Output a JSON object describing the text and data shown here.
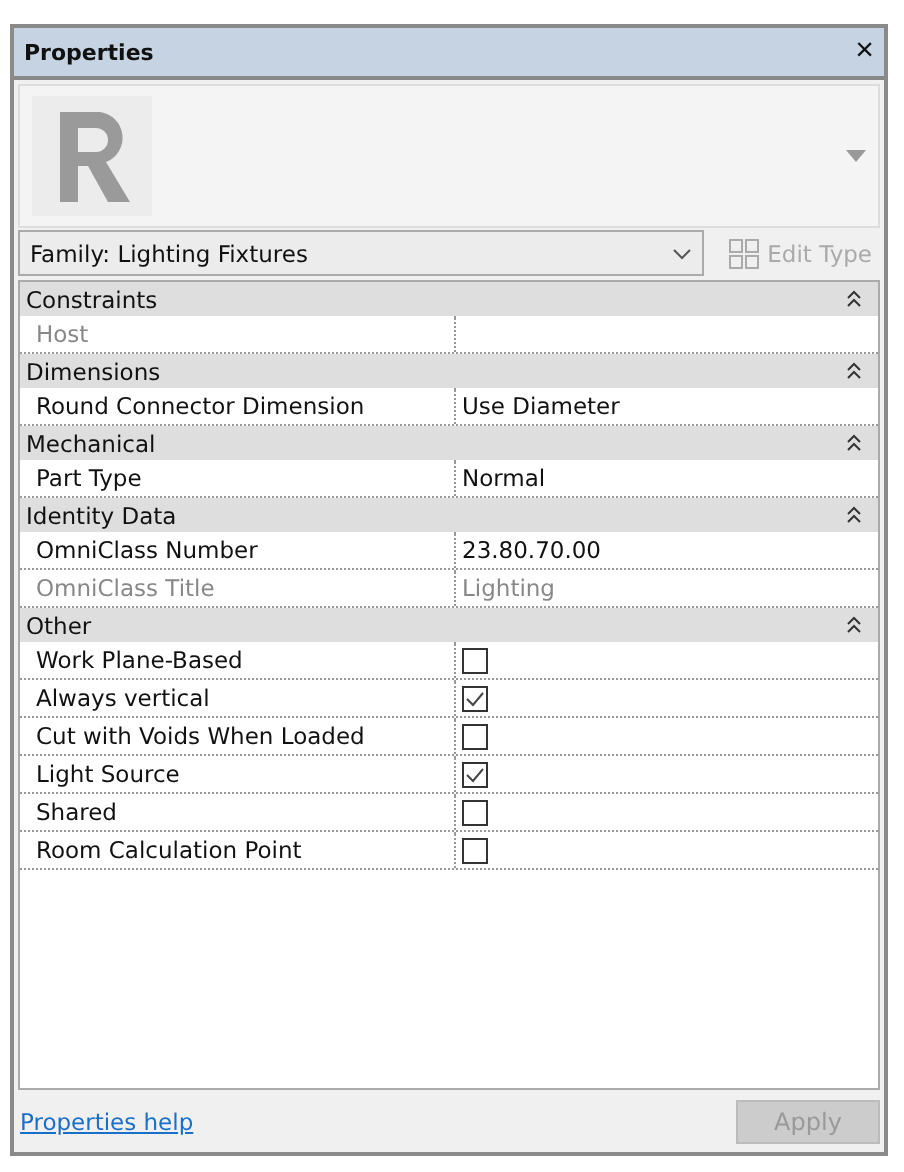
{
  "window": {
    "title": "Properties",
    "close": "×"
  },
  "type_selector": {
    "family": "Family: Lighting Fixtures",
    "edit_type": {
      "label": "Edit Type",
      "disabled": true
    }
  },
  "groups": [
    {
      "name": "Constraints",
      "expanded": true,
      "rows": [
        {
          "label": "Host",
          "kind": "text",
          "disabled": true
        }
      ]
    },
    {
      "name": "Dimensions",
      "expanded": true,
      "rows": [
        {
          "label": "Round Connector Dimension",
          "kind": "text",
          "value": "Use Diameter",
          "disabled": false
        }
      ]
    },
    {
      "name": "Mechanical",
      "expanded": true,
      "rows": [
        {
          "label": "Part Type",
          "kind": "text",
          "value": "Normal",
          "disabled": false
        }
      ]
    },
    {
      "name": "Identity Data",
      "expanded": true,
      "rows": [
        {
          "label": "OmniClass Number",
          "kind": "text",
          "value": "23.80.70.00",
          "disabled": false
        },
        {
          "label": "OmniClass Title",
          "kind": "text",
          "value": "Lighting",
          "disabled": true
        }
      ]
    },
    {
      "name": "Other",
      "expanded": true,
      "rows": [
        {
          "label": "Work Plane-Based",
          "kind": "checkbox",
          "checked": false,
          "disabled": false
        },
        {
          "label": "Always vertical",
          "kind": "checkbox",
          "checked": true,
          "disabled": false
        },
        {
          "label": "Cut with Voids When Loaded",
          "kind": "checkbox",
          "checked": false,
          "disabled": false
        },
        {
          "label": "Light Source",
          "kind": "checkbox",
          "checked": true,
          "disabled": false
        },
        {
          "label": "Shared",
          "kind": "checkbox",
          "checked": false,
          "disabled": false
        },
        {
          "label": "Room Calculation Point",
          "kind": "checkbox",
          "checked": false,
          "disabled": false
        }
      ]
    }
  ],
  "footer": {
    "help_link": "Properties help",
    "apply": {
      "label": "Apply",
      "disabled": true
    }
  }
}
